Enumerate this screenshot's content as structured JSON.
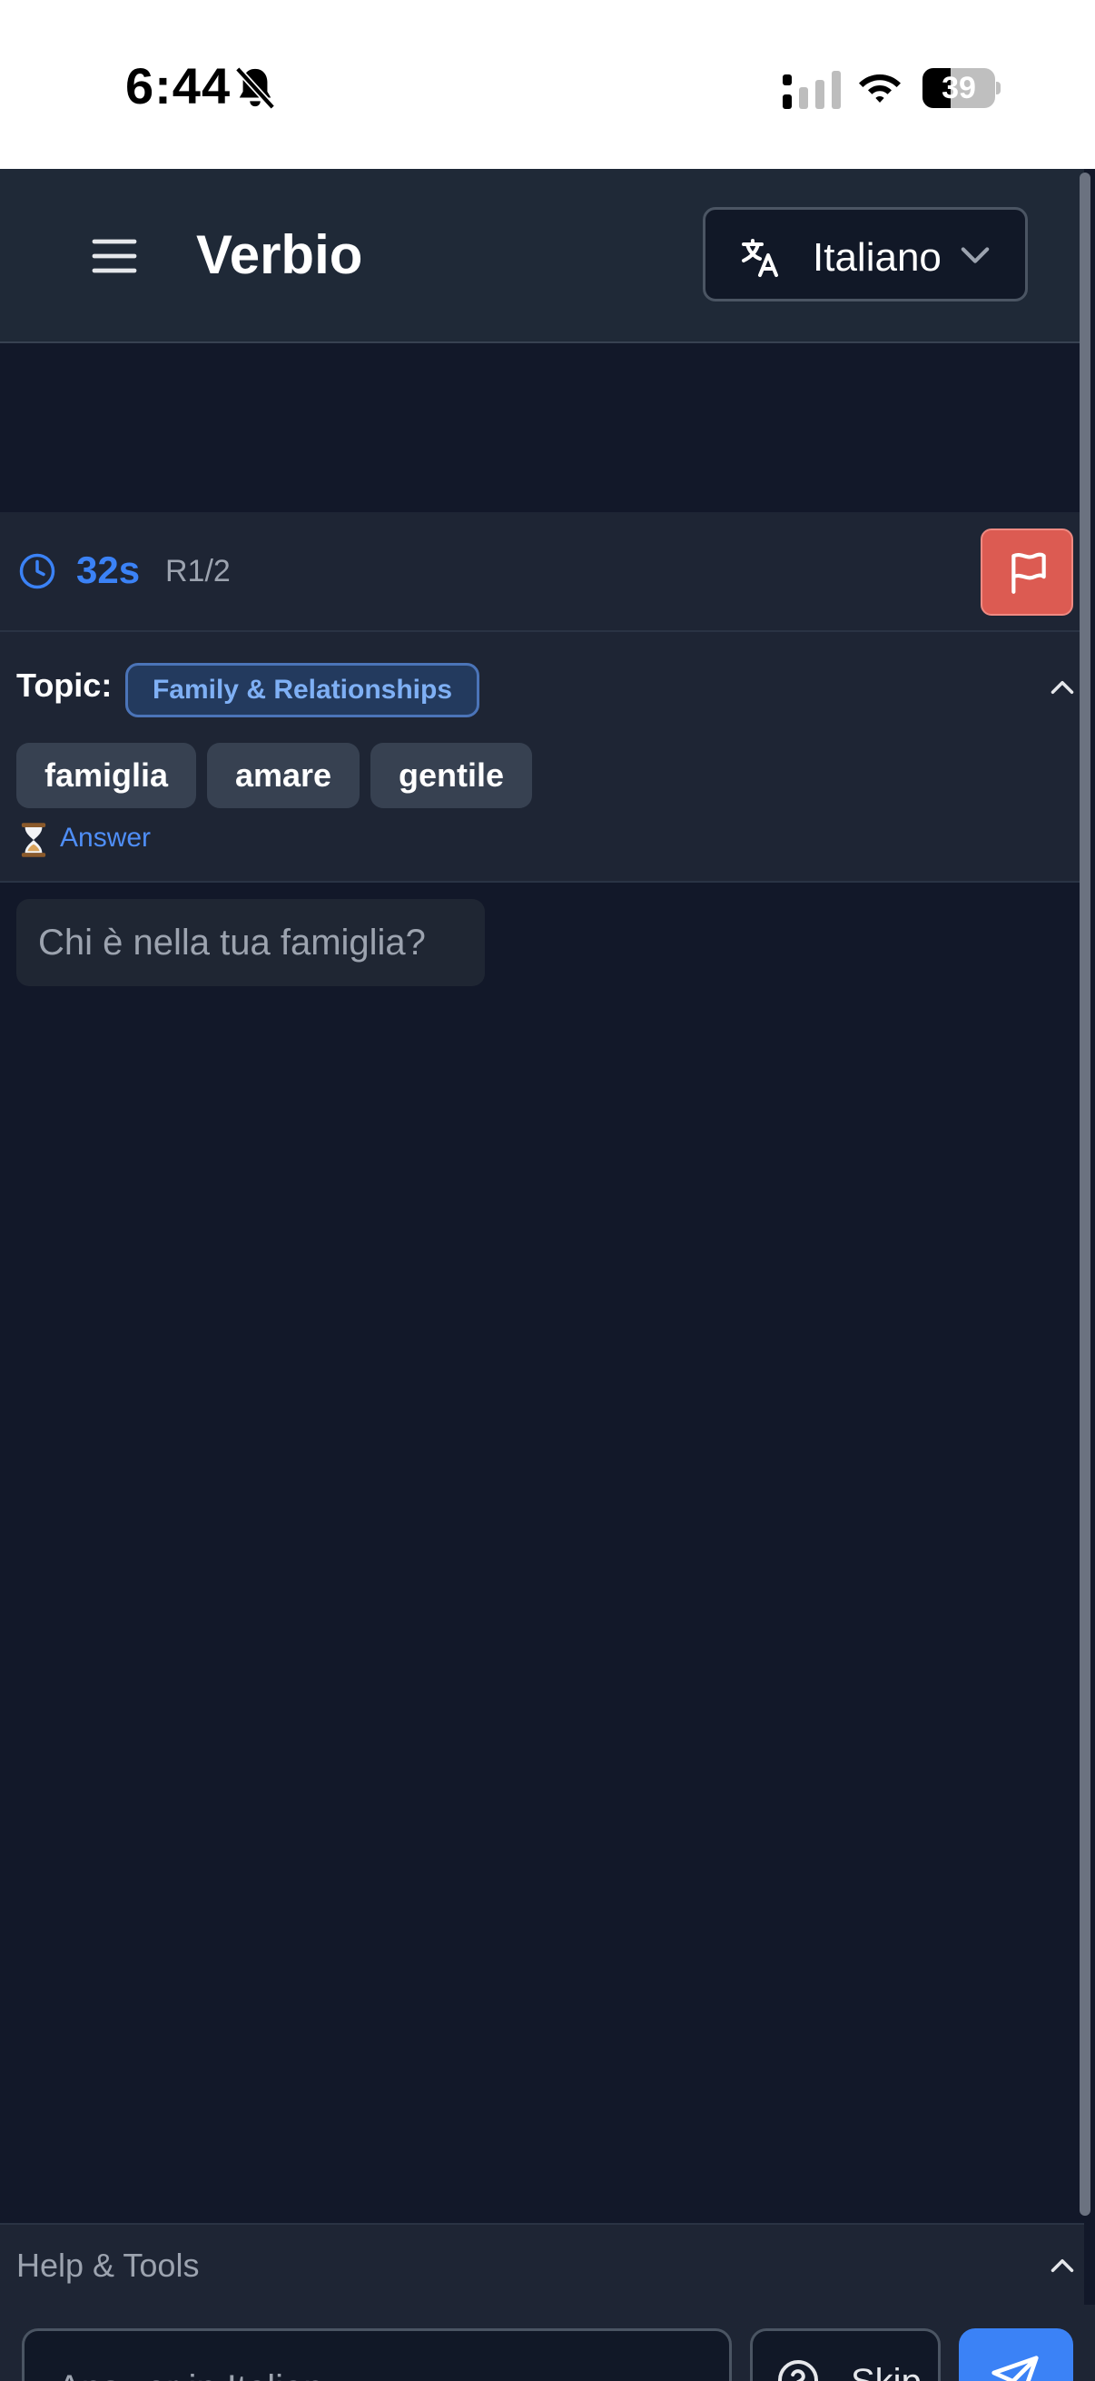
{
  "status_bar": {
    "time": "6:44",
    "battery_level": "39",
    "battery_fraction": 0.39,
    "icons": [
      "bell-slash-icon",
      "cellular-signal-icon",
      "wifi-icon",
      "battery-icon"
    ]
  },
  "header": {
    "title": "Verbio",
    "language": "Italiano",
    "menu_icon": "hamburger-menu-icon",
    "language_icon": "translate-icon",
    "dropdown_icon": "chevron-down-icon"
  },
  "timer": {
    "seconds": "32s",
    "round": "R1/2",
    "clock_icon": "clock-icon",
    "flag_icon": "flag-icon"
  },
  "topic": {
    "label": "Topic:",
    "name": "Family & Relationships",
    "words": [
      "famiglia",
      "amare",
      "gentile"
    ],
    "answer_prefix": "⏳",
    "answer_link": "Answer",
    "collapse_icon": "chevron-up-icon"
  },
  "question": {
    "text": "Chi è nella tua famiglia?"
  },
  "help_tools": {
    "label": "Help & Tools",
    "toggle_icon": "chevron-up-icon"
  },
  "input": {
    "placeholder": "Answer in Italian",
    "skip_label": "Skip",
    "skip_icon": "help-circle-icon",
    "send_icon": "send-icon"
  },
  "colors": {
    "background": "#121829",
    "panel": "#1e2534",
    "header": "#1f2937",
    "accent_blue": "#3b82f6",
    "flag_red": "#dc5b52",
    "chip": "#374151"
  }
}
